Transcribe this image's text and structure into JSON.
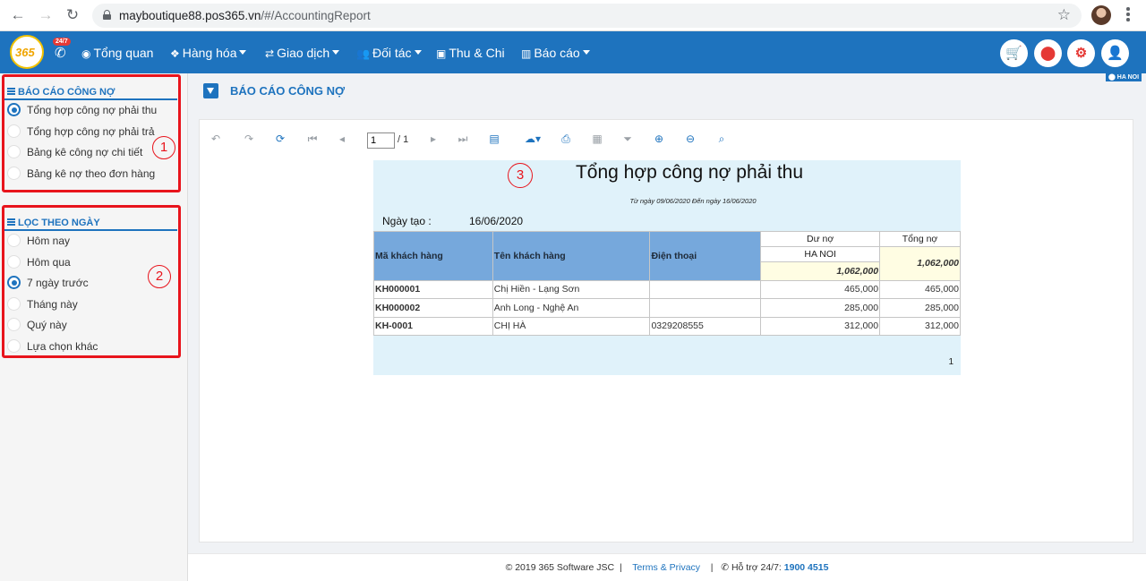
{
  "browser": {
    "url_domain": "mayboutique88.pos365.vn",
    "url_path": "/#/AccountingReport"
  },
  "topbar": {
    "logo_text": "365",
    "badge": "24/7",
    "menu": [
      {
        "label": "Tổng quan",
        "has_caret": false
      },
      {
        "label": "Hàng hóa",
        "has_caret": true
      },
      {
        "label": "Giao dịch",
        "has_caret": true
      },
      {
        "label": "Đối tác",
        "has_caret": true
      },
      {
        "label": "Thu & Chi",
        "has_caret": false
      },
      {
        "label": "Báo cáo",
        "has_caret": true
      }
    ],
    "branch_tag": "HA NOI"
  },
  "sidebar": {
    "report_group": {
      "title": "BÁO CÁO CÔNG NỢ",
      "items": [
        {
          "label": "Tổng hợp công nợ phải thu",
          "checked": true
        },
        {
          "label": "Tổng hợp công nợ phải trả",
          "checked": false
        },
        {
          "label": "Bảng kê công nợ chi tiết",
          "checked": false
        },
        {
          "label": "Bảng kê nợ theo đơn hàng",
          "checked": false
        }
      ],
      "marker": "1"
    },
    "date_group": {
      "title": "LỌC THEO NGÀY",
      "items": [
        {
          "label": "Hôm nay",
          "checked": false
        },
        {
          "label": "Hôm qua",
          "checked": false
        },
        {
          "label": "7 ngày trước",
          "checked": true
        },
        {
          "label": "Tháng này",
          "checked": false
        },
        {
          "label": "Quý này",
          "checked": false
        },
        {
          "label": "Lựa chọn khác",
          "checked": false
        }
      ],
      "marker": "2"
    }
  },
  "main": {
    "page_title": "BÁO CÁO CÔNG NỢ",
    "viewer": {
      "current_page": "1",
      "total_pages": "/ 1"
    },
    "report": {
      "marker": "3",
      "title": "Tổng hợp công nợ phải thu",
      "subtitle": "Từ ngày 09/06/2020 Đến ngày 16/06/2020",
      "created_label": "Ngày tạo :",
      "created_value": "16/06/2020",
      "columns": {
        "code": "Mã khách hàng",
        "name": "Tên khách hàng",
        "phone": "Điện thoại",
        "debt": "Dư nợ",
        "total": "Tổng nợ"
      },
      "branch": "HA NOI",
      "branch_total": "1,062,000",
      "grand_total": "1,062,000",
      "rows": [
        {
          "code": "KH000001",
          "name": "Chị Hiền - Lạng Sơn",
          "phone": "",
          "debt": "465,000",
          "total": "465,000"
        },
        {
          "code": "KH000002",
          "name": "Anh Long - Nghệ An",
          "phone": "",
          "debt": "285,000",
          "total": "285,000"
        },
        {
          "code": "KH-0001",
          "name": "CHỊ HÀ",
          "phone": "0329208555",
          "debt": "312,000",
          "total": "312,000"
        }
      ],
      "page_number": "1"
    }
  },
  "footer": {
    "copyright": "© 2019 365 Software JSC",
    "sep1": "|",
    "terms": "Terms & Privacy",
    "sep2": "|",
    "support_label": "Hỗ trợ 24/7:",
    "support_phone": "1900 4515"
  },
  "colors": {
    "brand_blue": "#1e73be",
    "highlight_red": "#e8141c",
    "report_bg": "#e0f2fa",
    "header_blue": "#76a8dc"
  }
}
